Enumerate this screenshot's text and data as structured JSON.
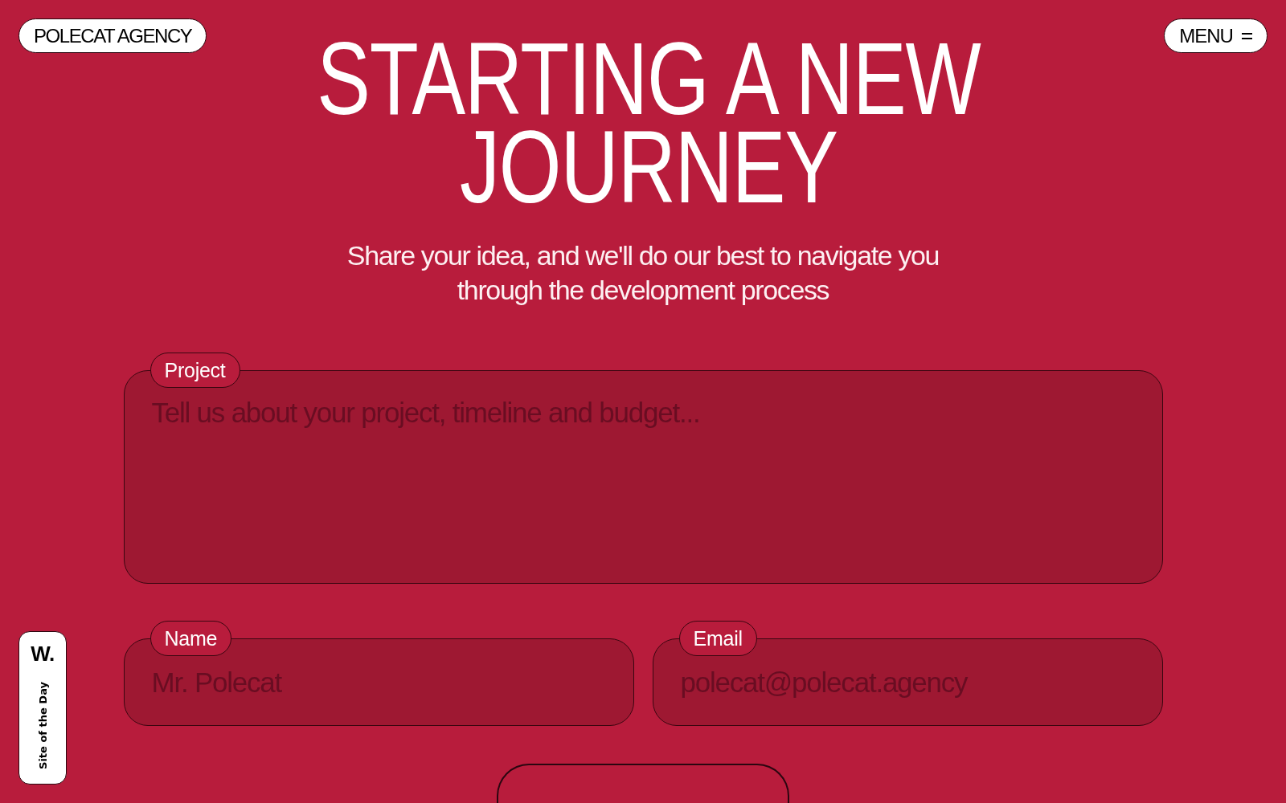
{
  "header": {
    "logo": "POLECAT AGENCY",
    "menu_button": "MENU"
  },
  "hero": {
    "title_lines": [
      "STARTING A NEW",
      "JOURNEY"
    ],
    "subtitle": "Share your idea, and we'll do our best to navigate you through the development process"
  },
  "form": {
    "fields": [
      {
        "kind": "textarea",
        "label": "Project",
        "placeholder": "Tell us about your project, timeline and budget..."
      },
      {
        "kind": "text",
        "label": "Name",
        "placeholder": "Mr. Polecat"
      },
      {
        "kind": "email",
        "label": "Email",
        "placeholder": "polecat@polecat.agency"
      }
    ]
  },
  "award_badge": {
    "logo": "W.",
    "label": "Site of the Day"
  }
}
